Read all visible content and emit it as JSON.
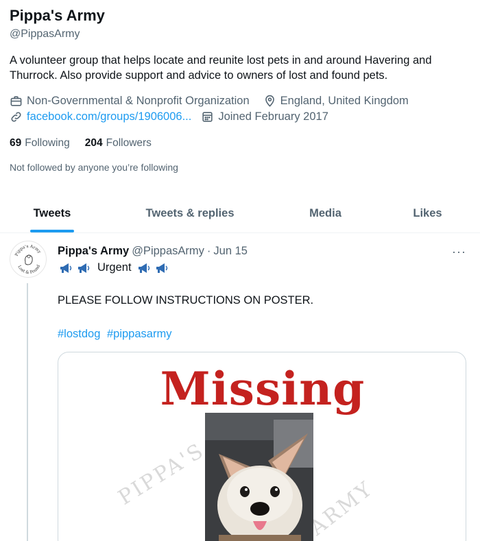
{
  "profile": {
    "name": "Pippa's Army",
    "handle": "@PippasArmy",
    "bio": "A volunteer group that helps locate and reunite lost pets in and around Havering and Thurrock. Also provide support and advice to owners of lost and found pets.",
    "category": "Non-Governmental & Nonprofit Organization",
    "location": "England, United Kingdom",
    "website": "facebook.com/groups/1906006...",
    "joined": "Joined February 2017",
    "following_count": "69",
    "following_label": "Following",
    "followers_count": "204",
    "followers_label": "Followers",
    "not_followed": "Not followed by anyone you’re following"
  },
  "tabs": [
    {
      "label": "Tweets",
      "active": true
    },
    {
      "label": "Tweets & replies",
      "active": false
    },
    {
      "label": "Media",
      "active": false
    },
    {
      "label": "Likes",
      "active": false
    }
  ],
  "tweet": {
    "author_name": "Pippa's Army",
    "author_handle": "@PippasArmy",
    "separator": "·",
    "date": "Jun 15",
    "more": "···",
    "urgent": "Urgent",
    "text": "PLEASE FOLLOW INSTRUCTIONS ON POSTER.",
    "hashtags": [
      "#lostdog",
      "#pippasarmy"
    ],
    "media": {
      "title": "Missing",
      "watermark_left": "PIPPA'S",
      "watermark_right": "ARMY"
    },
    "avatar_text_top": "Pippa's Army",
    "avatar_text_bottom": "Lost & Found"
  },
  "colors": {
    "accent": "#1d9bf0",
    "secondary_text": "#536471",
    "poster_red": "#c4221f",
    "megaphone": "#2f6cb3"
  },
  "icons": {
    "category": "briefcase-icon",
    "location": "location-pin-icon",
    "website": "link-icon",
    "joined": "calendar-icon",
    "urgent": "megaphone-icon"
  }
}
